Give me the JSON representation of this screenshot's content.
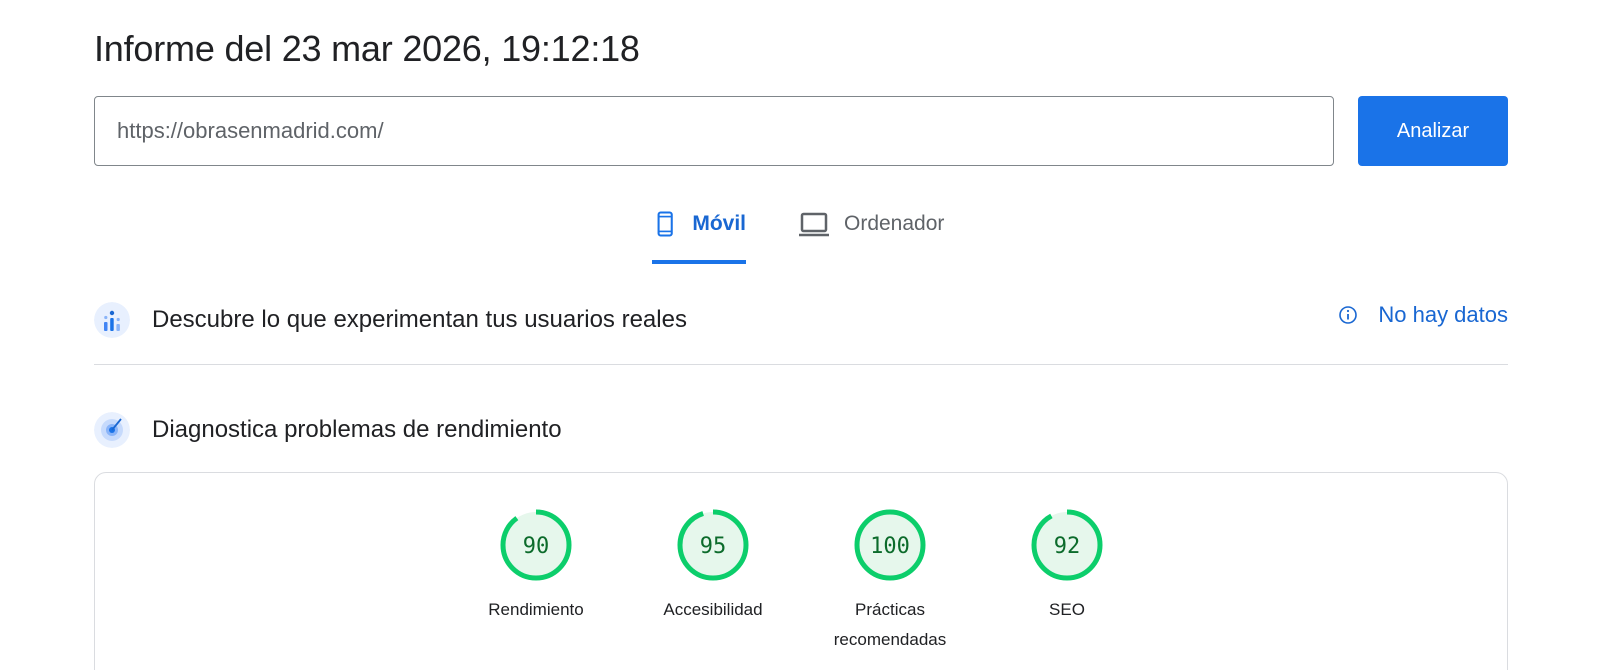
{
  "report": {
    "title": "Informe del 23 mar 2026, 19:12:18"
  },
  "search": {
    "url_value": "https://obrasenmadrid.com/",
    "analyze_label": "Analizar"
  },
  "tabs": [
    {
      "label": "Móvil",
      "icon": "smartphone-icon",
      "active": true
    },
    {
      "label": "Ordenador",
      "icon": "laptop-icon",
      "active": false
    }
  ],
  "field_data": {
    "title": "Descubre lo que experimentan tus usuarios reales",
    "icon": "users-chart-icon",
    "status_label": "No hay datos",
    "status_icon": "info-icon"
  },
  "lab_data": {
    "title": "Diagnostica problemas de rendimiento",
    "icon": "radar-icon"
  },
  "scores": [
    {
      "value": 90,
      "label_lines": [
        "Rendimiento"
      ]
    },
    {
      "value": 95,
      "label_lines": [
        "Accesibilidad"
      ]
    },
    {
      "value": 100,
      "label_lines": [
        "Prácticas",
        "recomendadas"
      ]
    },
    {
      "value": 92,
      "label_lines": [
        "SEO"
      ]
    }
  ],
  "colors": {
    "accent": "#1a73e8",
    "link": "#1967d2",
    "score_good_stroke": "#0cce6b",
    "score_good_fill": "#e6f7ec",
    "score_good_text": "#0c6b2b"
  }
}
